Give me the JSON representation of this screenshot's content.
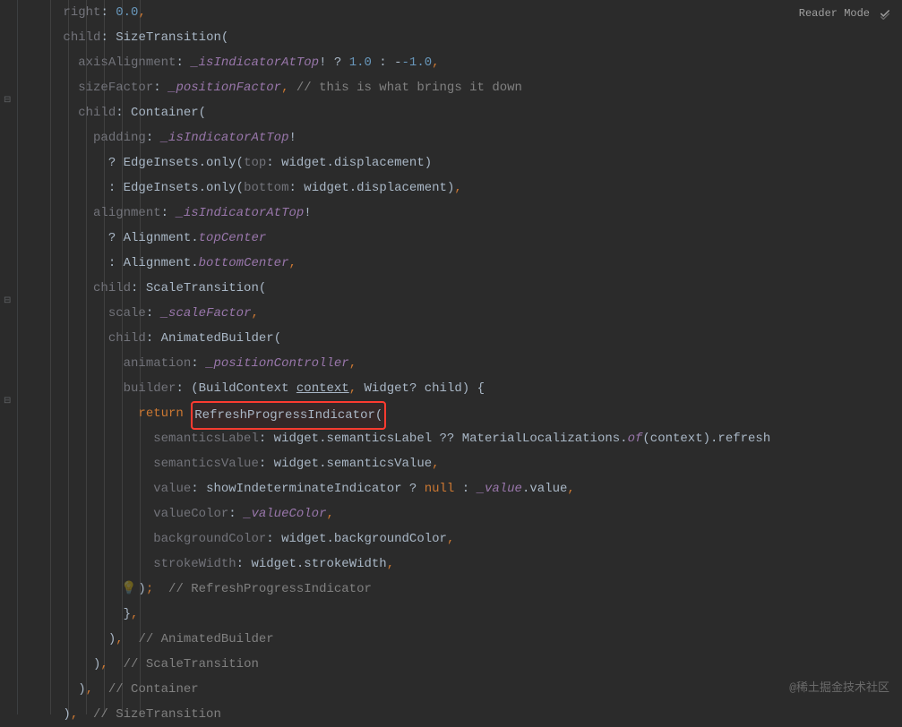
{
  "topRight": {
    "label": "Reader Mode"
  },
  "watermark": "@稀土掘金技术社区",
  "highlightText": "RefreshProgressIndicator(",
  "code": {
    "l0": {
      "param": "right",
      "val": "0.0"
    },
    "l1": {
      "param": "child",
      "cls": "SizeTransition"
    },
    "l2": {
      "param": "axisAlignment",
      "field": "_isIndicatorAtTop",
      "t": "1.0",
      "f": "-1.0"
    },
    "l3": {
      "param": "sizeFactor",
      "field": "_positionFactor",
      "comment": "// this is what brings it down"
    },
    "l4": {
      "param": "child",
      "cls": "Container"
    },
    "l5": {
      "param": "padding",
      "field": "_isIndicatorAtTop"
    },
    "l6": {
      "cls": "EdgeInsets",
      "m": "only",
      "p": "top",
      "w": "widget",
      "d": "displacement"
    },
    "l7": {
      "cls": "EdgeInsets",
      "m": "only",
      "p": "bottom",
      "w": "widget",
      "d": "displacement"
    },
    "l8": {
      "param": "alignment",
      "field": "_isIndicatorAtTop"
    },
    "l9": {
      "cls": "Alignment",
      "p": "topCenter"
    },
    "l10": {
      "cls": "Alignment",
      "p": "bottomCenter"
    },
    "l11": {
      "param": "child",
      "cls": "ScaleTransition"
    },
    "l12": {
      "param": "scale",
      "field": "_scaleFactor"
    },
    "l13": {
      "param": "child",
      "cls": "AnimatedBuilder"
    },
    "l14": {
      "param": "animation",
      "field": "_positionController"
    },
    "l15": {
      "param": "builder",
      "bc": "BuildContext",
      "ctx": "context",
      "wg": "Widget",
      "ch": "child"
    },
    "l16": {
      "kw": "return "
    },
    "l17": {
      "param": "semanticsLabel",
      "w": "widget",
      "f": "semanticsLabel",
      "ml": "MaterialLocalizations",
      "of": "of",
      "ctx": "context",
      "ref": "refresh"
    },
    "l18": {
      "param": "semanticsValue",
      "w": "widget",
      "f": "semanticsValue"
    },
    "l19": {
      "param": "value",
      "sh": "showIndeterminateIndicator",
      "n": "null",
      "v": "_value",
      "vv": "value"
    },
    "l20": {
      "param": "valueColor",
      "f": "_valueColor"
    },
    "l21": {
      "param": "backgroundColor",
      "w": "widget",
      "f": "backgroundColor"
    },
    "l22": {
      "param": "strokeWidth",
      "w": "widget",
      "f": "strokeWidth"
    },
    "l23": {
      "comment": "// RefreshProgressIndicator"
    },
    "l25": {
      "comment": "// AnimatedBuilder"
    },
    "l26": {
      "comment": "// ScaleTransition"
    },
    "l27": {
      "comment": "// Container"
    },
    "l28": {
      "comment": "// SizeTransition"
    }
  }
}
